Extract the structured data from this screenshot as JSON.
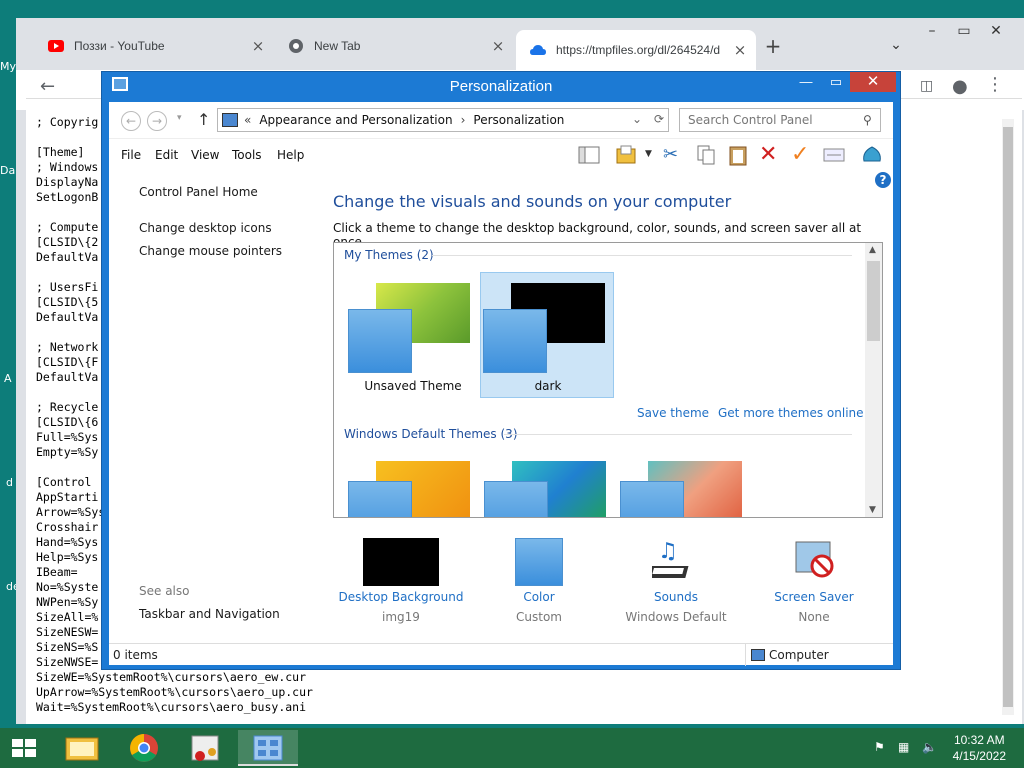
{
  "desktop": {
    "labels": [
      "My",
      "Da",
      "A",
      "d",
      "de"
    ]
  },
  "chrome": {
    "tabs": [
      {
        "title": "Поззи - YouTube",
        "close": "×"
      },
      {
        "title": "New Tab",
        "close": "×"
      },
      {
        "title": "https://tmpfiles.org/dl/264524/d",
        "close": "×"
      }
    ],
    "new_tab": "+",
    "code_lines": [
      "; Copyrig",
      "",
      "[Theme]",
      "; Windows",
      "DisplayNa",
      "SetLogonB",
      "",
      "; Compute",
      "[CLSID\\{2",
      "DefaultVa",
      "",
      "; UsersFi",
      "[CLSID\\{5",
      "DefaultVa",
      "",
      "; Network",
      "[CLSID\\{F",
      "DefaultVa",
      "",
      "; Recycle",
      "[CLSID\\{6",
      "Full=%Sys",
      "Empty=%Sy",
      "",
      "[Control",
      "AppStarti",
      "Arrow=%Sys",
      "Crosshair",
      "Hand=%Sys",
      "Help=%Sys",
      "IBeam=",
      "No=%Syste",
      "NWPen=%Sy",
      "SizeAll=%",
      "SizeNESW=",
      "SizeNS=%S",
      "SizeNWSE=",
      "SizeWE=%SystemRoot%\\cursors\\aero_ew.cur",
      "UpArrow=%SystemRoot%\\cursors\\aero_up.cur",
      "Wait=%SystemRoot%\\cursors\\aero_busy.ani"
    ]
  },
  "cp": {
    "title": "Personalization",
    "breadcrumb": {
      "prefix": "«",
      "parent": "Appearance and Personalization",
      "sep": "›",
      "current": "Personalization"
    },
    "search_placeholder": "Search Control Panel",
    "menu": [
      "File",
      "Edit",
      "View",
      "Tools",
      "Help"
    ],
    "left": {
      "home": "Control Panel Home",
      "links": [
        "Change desktop icons",
        "Change mouse pointers"
      ],
      "see_also_heading": "See also",
      "see_also": [
        "Taskbar and Navigation"
      ]
    },
    "heading": "Change the visuals and sounds on your computer",
    "subheading": "Click a theme to change the desktop background, color, sounds, and screen saver all at once.",
    "my_themes_label": "My Themes (2)",
    "my_themes": [
      {
        "name": "Unsaved Theme"
      },
      {
        "name": "dark"
      }
    ],
    "save_theme": "Save theme",
    "get_more": "Get more themes online",
    "default_themes_label": "Windows Default Themes (3)",
    "bottom": [
      {
        "label": "Desktop Background",
        "value": "img19"
      },
      {
        "label": "Color",
        "value": "Custom"
      },
      {
        "label": "Sounds",
        "value": "Windows Default"
      },
      {
        "label": "Screen Saver",
        "value": "None"
      }
    ],
    "status_items": "0 items",
    "status_location": "Computer"
  },
  "taskbar": {
    "time": "10:32 AM",
    "date": "4/15/2022"
  }
}
